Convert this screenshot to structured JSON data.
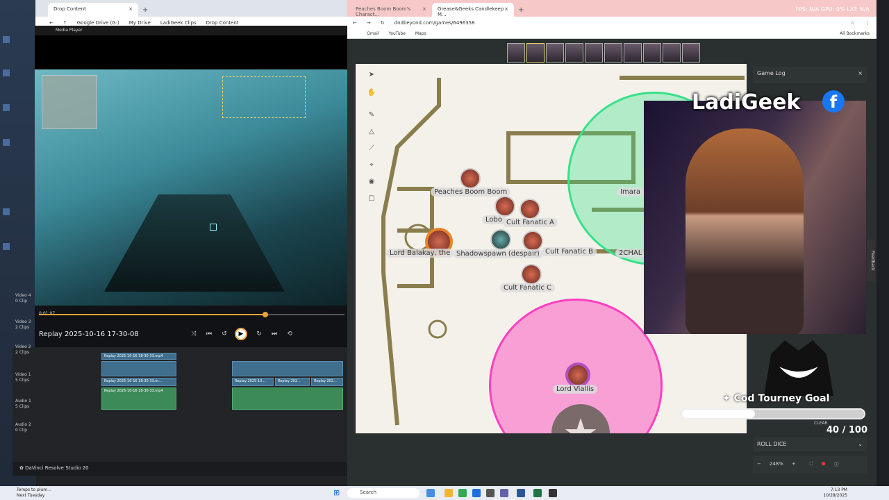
{
  "left_browser": {
    "tab_title": "Drop Content",
    "breadcrumb": [
      "Google Drive (G:)",
      "My Drive",
      "LadiGeek Clips",
      "Drop Content"
    ]
  },
  "media_player": {
    "title": "Media Player",
    "timestamp": "0:01:07",
    "progress_percent": 74,
    "file_name": "Replay 2025-10-16 17-30-08"
  },
  "timeline": {
    "tracks": [
      {
        "id": "Video 4",
        "clips": "0 Clip"
      },
      {
        "id": "Video 3",
        "clips": "2 Clips"
      },
      {
        "id": "Video 2",
        "clips": "2 Clips"
      },
      {
        "id": "Video 1",
        "clips": "5 Clips"
      },
      {
        "id": "Audio 1",
        "clips": "5 Clips"
      },
      {
        "id": "Audio 2",
        "clips": "0 Clip"
      }
    ],
    "clip_names": [
      "Replay 2025-10-16 18-30-33.mp4",
      "Replay 2025-10-16 18-30-33.m...",
      "Replay 2025-10-16 18-30-33.mp4",
      "Replay 2025-10...",
      "Replay 202...",
      "Replay 202..."
    ],
    "app_name": "DaVinci Resolve Studio 20"
  },
  "right_browser": {
    "tabs": [
      "Peaches Boom Boom's Charact...",
      "Grease&Geeks Candlekeep M..."
    ],
    "url": "dndbeyond.com/games/6496358",
    "bookmarks": [
      "Gmail",
      "YouTube",
      "Maps"
    ],
    "all_bookmarks": "All Bookmarks",
    "overlay_stats": "FPS: N/A   GPU: 0%    LAT: N/A"
  },
  "map": {
    "tokens": [
      "Peaches Boom Boom",
      "Lobo",
      "Cult Fanatic A",
      "Lord Balakay, the",
      "Shadowspawn (despair)",
      "Cult Fanatic B",
      "Cult Fanatic C",
      "Lord Viallis",
      "Imara",
      "2CHAL"
    ]
  },
  "stream": {
    "brand": "LadiGeek",
    "facebook_glyph": "f",
    "game_log": "Game Log",
    "goal_title": "Cod Tourney Goal",
    "goal_value": "40 / 100",
    "goal_progress": 0.4,
    "goal_clear": "CLEAR",
    "roll_dice": "ROLL DICE",
    "zoom": "248%",
    "feedback": "Feedback"
  },
  "taskbar": {
    "weather_line1": "Temps to plum...",
    "weather_line2": "Next Tuesday",
    "search": "Search",
    "time": "7:13 PM",
    "date": "10/28/2025"
  },
  "colors": {
    "accent_orange": "#e8a33a",
    "aura_pink": "#ff3fbf",
    "aura_green": "#38e08a",
    "facebook_blue": "#1877f2"
  }
}
